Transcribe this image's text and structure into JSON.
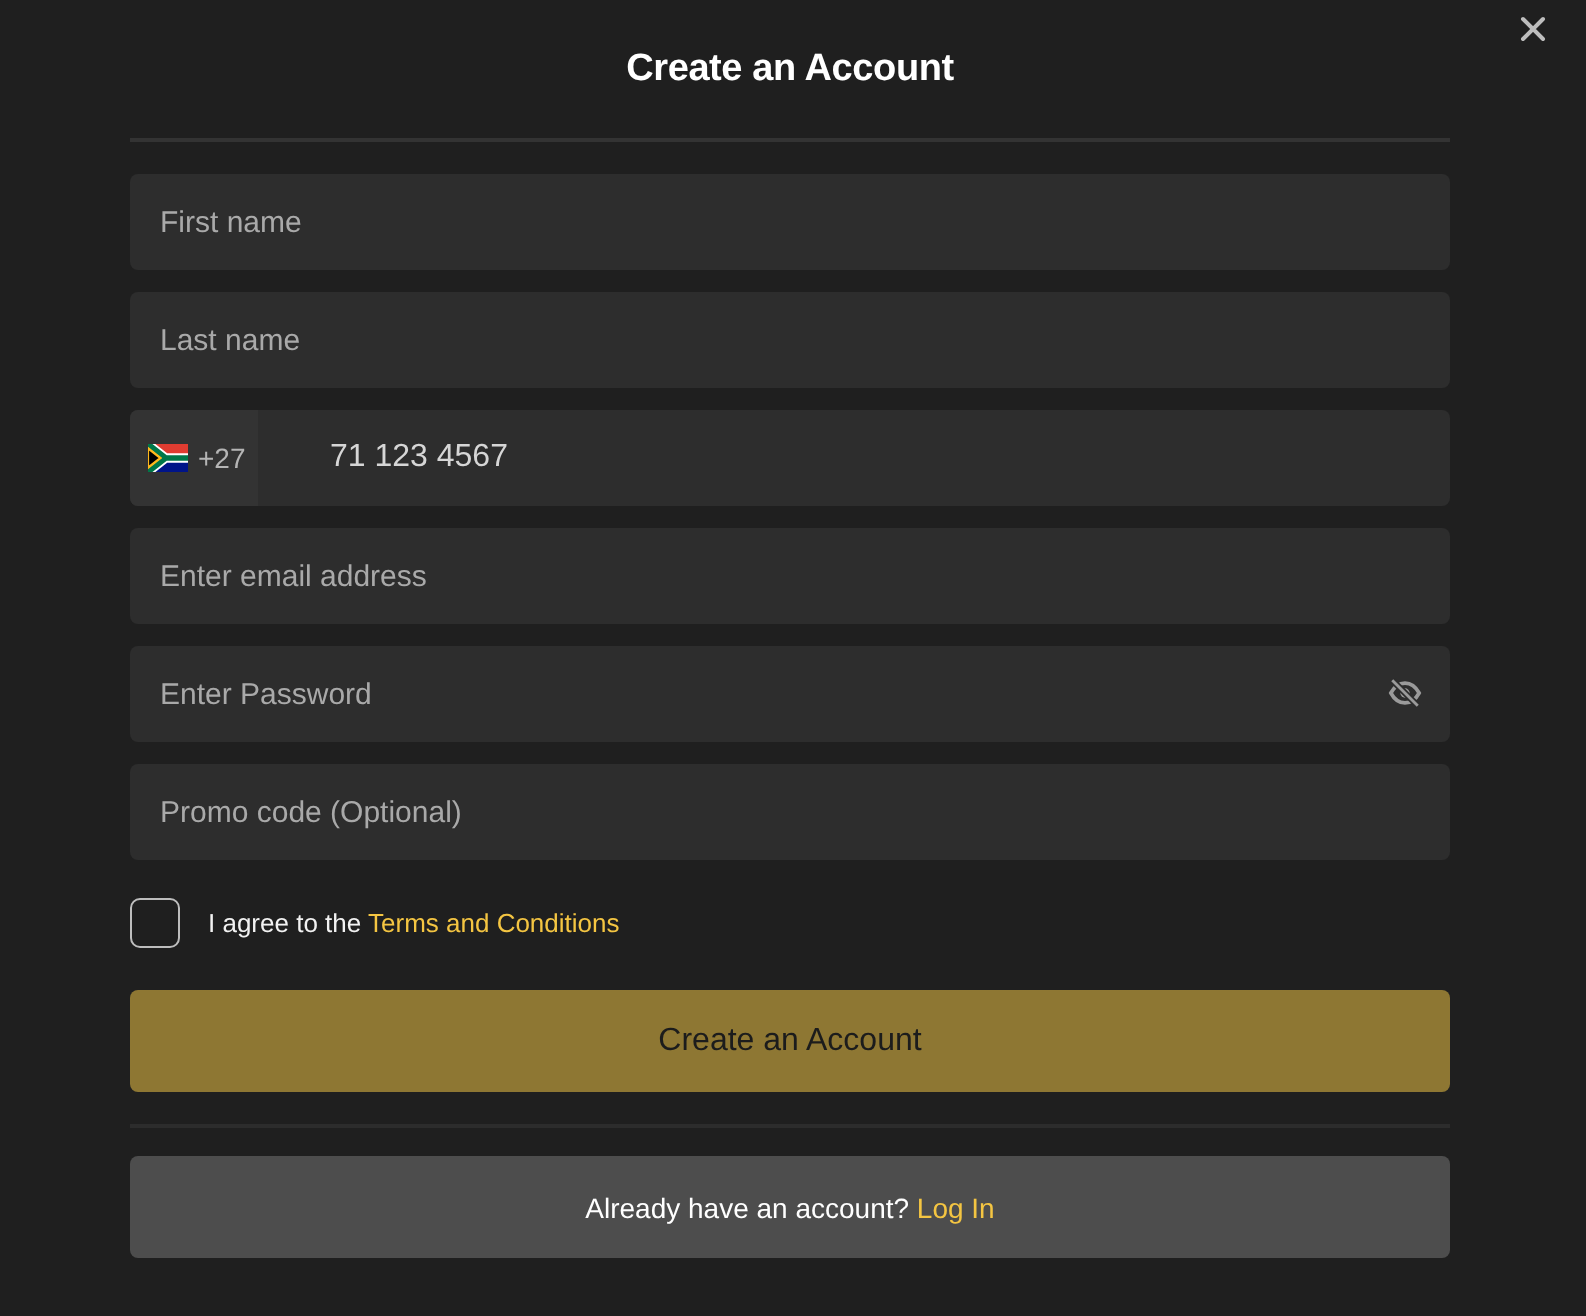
{
  "dialog": {
    "title": "Create an Account"
  },
  "fields": [
    {
      "kind": "text",
      "placeholder": "First name"
    },
    {
      "kind": "text",
      "placeholder": "Last name"
    },
    {
      "kind": "phone",
      "country_code": "+27",
      "value": "71 123 4567"
    },
    {
      "kind": "text",
      "placeholder": "Enter email address"
    },
    {
      "kind": "password",
      "placeholder": "Enter Password"
    },
    {
      "kind": "text",
      "placeholder": "Promo code (Optional)"
    }
  ],
  "terms": {
    "checked": false,
    "text": "I agree to the",
    "link": "Terms and Conditions"
  },
  "submit_button": {
    "label": "Create an Account"
  },
  "login": {
    "text": "Already have an account?",
    "link": "Log In"
  }
}
